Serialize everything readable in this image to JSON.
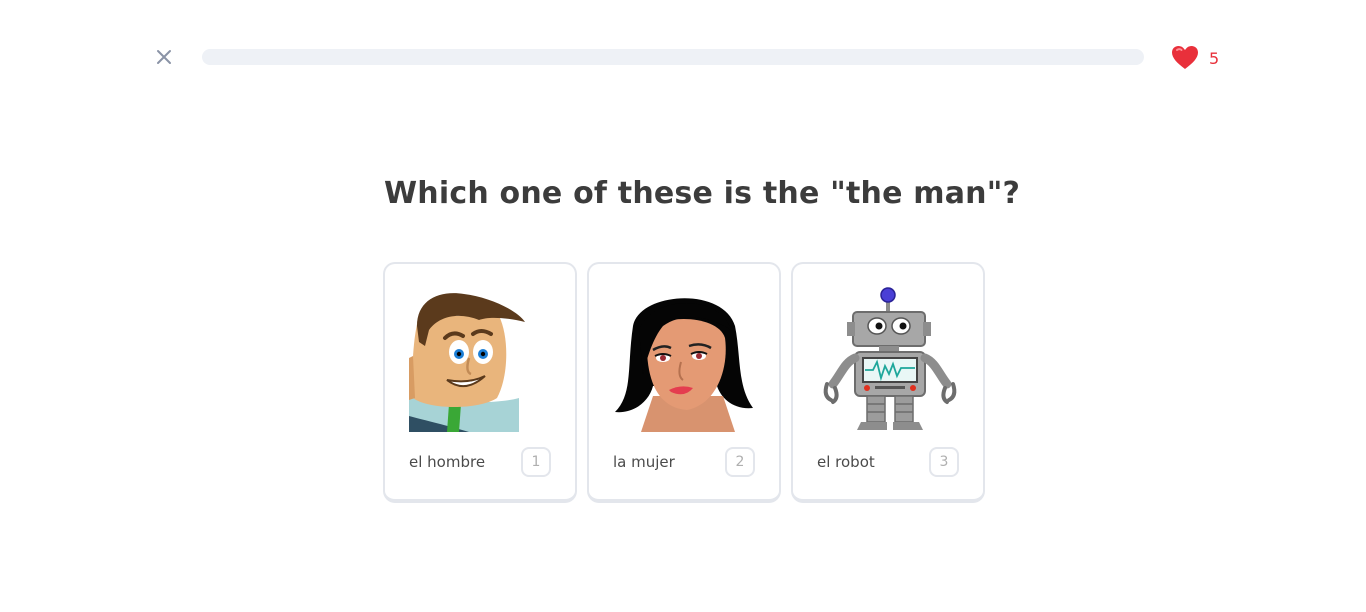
{
  "header": {
    "close_icon": "close-icon",
    "progress_fraction": 0,
    "hearts_icon": "heart-icon",
    "hearts_count": "5",
    "accent_color": "#e8313b"
  },
  "question": {
    "text": "Which one of these is the \"the man\"?"
  },
  "options": [
    {
      "label": "el hombre",
      "key": "1",
      "image": "man-illustration"
    },
    {
      "label": "la mujer",
      "key": "2",
      "image": "woman-illustration"
    },
    {
      "label": "el robot",
      "key": "3",
      "image": "robot-illustration"
    }
  ]
}
